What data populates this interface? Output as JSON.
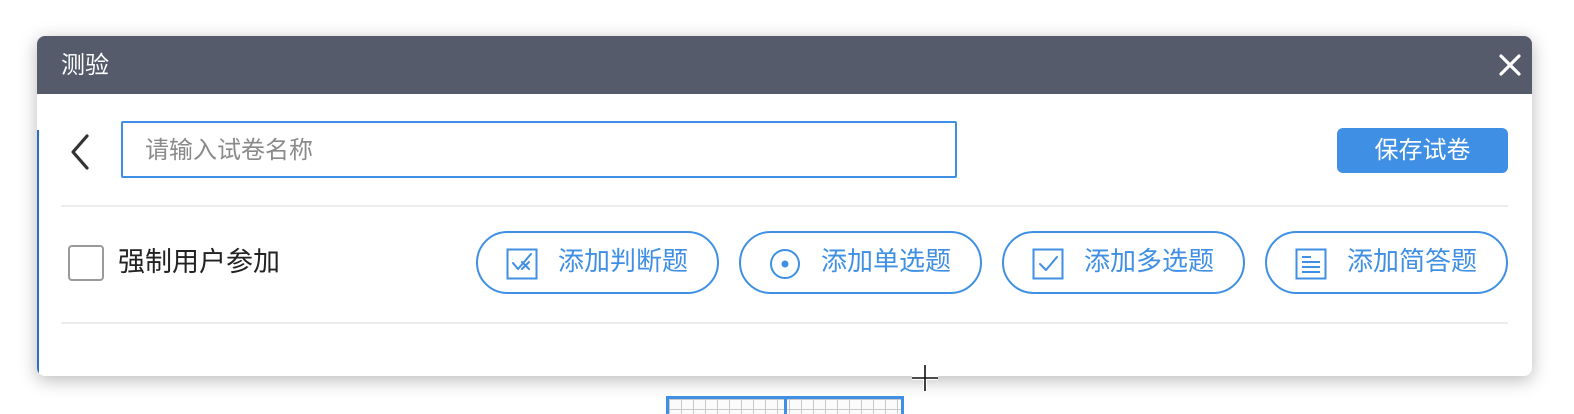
{
  "dialog": {
    "title": "测验",
    "close_icon": "close-icon"
  },
  "toolbar": {
    "back_icon": "chevron-left-icon",
    "name_input": {
      "placeholder": "请输入试卷名称",
      "value": ""
    },
    "save_label": "保存试卷"
  },
  "options": {
    "force_join_label": "强制用户参加",
    "force_join_checked": false
  },
  "add_buttons": [
    {
      "label": "添加判断题",
      "icon": "true-false-icon"
    },
    {
      "label": "添加单选题",
      "icon": "radio-icon"
    },
    {
      "label": "添加多选题",
      "icon": "checkbox-icon"
    },
    {
      "label": "添加简答题",
      "icon": "document-lines-icon"
    }
  ],
  "colors": {
    "accent": "#3f8fe4",
    "titlebar": "#555b6b",
    "divider": "#ececec"
  }
}
